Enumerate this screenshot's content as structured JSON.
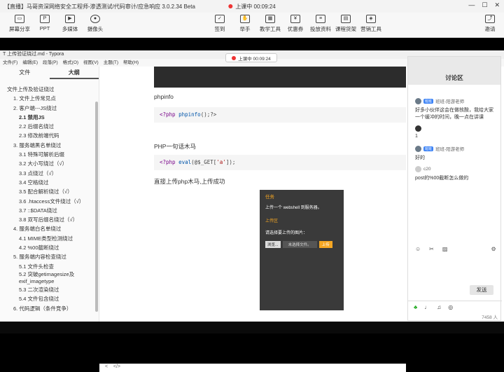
{
  "window": {
    "title": "【直播】马哥资深网络安全工程师-渗透测试/代码审计/应急响应 3.0.2.34 Beta",
    "live_status": "上课中 00:09:24"
  },
  "toolbar": {
    "left": [
      {
        "label": "屏幕分享",
        "icon": "screen-share-icon"
      },
      {
        "label": "PPT",
        "icon": "ppt-icon"
      },
      {
        "label": "多媒体",
        "icon": "media-icon"
      },
      {
        "label": "摄像头",
        "icon": "camera-icon"
      }
    ],
    "middle": [
      {
        "label": "签到",
        "icon": "checkin-icon"
      },
      {
        "label": "举手",
        "icon": "hand-icon"
      },
      {
        "label": "教学工具",
        "icon": "tools-icon"
      },
      {
        "label": "优惠券",
        "icon": "coupon-icon"
      },
      {
        "label": "投放资料",
        "icon": "file-icon"
      },
      {
        "label": "课程货架",
        "icon": "shelf-icon"
      },
      {
        "label": "营销工具",
        "icon": "marketing-icon"
      }
    ],
    "right": {
      "label": "邀请",
      "icon": "invite-icon"
    }
  },
  "typora": {
    "title": "上传验证绕过.md - Typora",
    "menu": [
      "文件(F)",
      "编辑(E)",
      "段落(P)",
      "格式(O)",
      "视图(V)",
      "主题(T)",
      "帮助(H)"
    ],
    "live_pill": "上课中 00:09:24",
    "sidebar_tabs": [
      "文件",
      "大纲"
    ],
    "outline": [
      {
        "text": "文件上传及验证绕过",
        "level": 1
      },
      {
        "text": "1. 文件上传常见点",
        "level": 2
      },
      {
        "text": "2. 客户端---JS绕过",
        "level": 2
      },
      {
        "text": "2.1 禁用JS",
        "level": 3,
        "bold": true
      },
      {
        "text": "2.2 后缀名绕过",
        "level": 3
      },
      {
        "text": "2.3 修改前端代码",
        "level": 3
      },
      {
        "text": "3. 服务端黑名单绕过",
        "level": 2
      },
      {
        "text": "3.1 特殊可解析后缀",
        "level": 3
      },
      {
        "text": "3.2 大小写绕过（√）",
        "level": 3
      },
      {
        "text": "3.3 点绕过（√）",
        "level": 3
      },
      {
        "text": "3.4 空格绕过",
        "level": 3
      },
      {
        "text": "3.5 配合解析绕过（√）",
        "level": 3
      },
      {
        "text": "3.6 .htaccess文件绕过（√）",
        "level": 3
      },
      {
        "text": "3.7 ::$DATA绕过",
        "level": 3
      },
      {
        "text": "3.8 双写后缀名绕过（√）",
        "level": 3
      },
      {
        "text": "4. 服务端白名单绕过",
        "level": 2
      },
      {
        "text": "4.1 MIME类型检测绕过",
        "level": 3
      },
      {
        "text": "4.2 %00截断绕过",
        "level": 3
      },
      {
        "text": "5. 服务端内容检查绕过",
        "level": 2
      },
      {
        "text": "5.1 文件头检查",
        "level": 3
      },
      {
        "text": "5.2 突破getimagesize及exif_imagetype",
        "level": 3,
        "wrap": true
      },
      {
        "text": "5.3 二次渲染绕过",
        "level": 3
      },
      {
        "text": "5.4 文件包含绕过",
        "level": 3
      },
      {
        "text": "6. 代码逻辑（条件竞争）",
        "level": 2
      }
    ],
    "content": {
      "h1": "phpinfo",
      "code1": {
        "open": "<?php ",
        "fn": "phpinfo",
        "rest": "();?>"
      },
      "h2": "PHP一句话木马",
      "code2": {
        "open": "<?php ",
        "fn": "eval",
        "pre": "(@$_GET[",
        "str": "'a'",
        "post": "]);"
      },
      "p1": "直接上传php木马,上传成功",
      "upload": {
        "title": "任务",
        "desc": "上传一个 webshell 到服务器。",
        "section": "上传区",
        "prompt": "请选择要上传的图片：",
        "browse": "浏览...",
        "no_file": "未选择文件。",
        "submit": "上传"
      }
    },
    "bottom_icons": [
      "<",
      "</>"
    ]
  },
  "chat": {
    "title": "讨论区",
    "messages": [
      {
        "name": "班班-阳游老师",
        "tag": "班班",
        "text": "好多小伙伴这会在做核酸，我给大家一个缓冲的时间，晚一点在讲课"
      },
      {
        "name": "",
        "text": "1"
      },
      {
        "name": "班班-阳游老师",
        "tag": "班班",
        "text": "好的"
      },
      {
        "name": "c20",
        "text": "post的%00截断怎么做的"
      }
    ],
    "tools": [
      "smile-icon",
      "scissors-icon",
      "image-icon",
      "settings-icon"
    ],
    "send": "发送",
    "count": "7458 人"
  },
  "colors": {
    "accent_orange": "#f5a623",
    "live_red": "#ee3333"
  }
}
